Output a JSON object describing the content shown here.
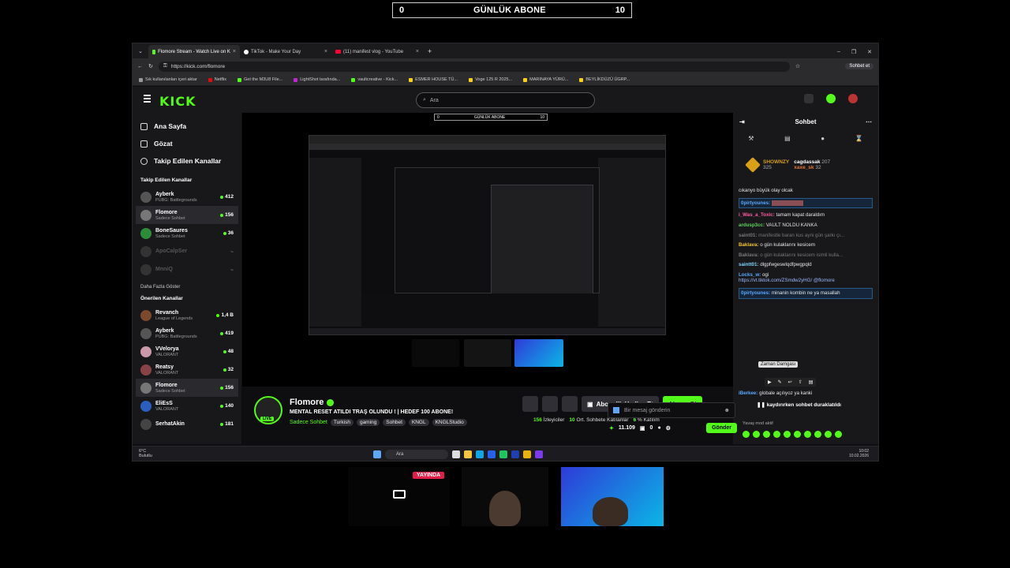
{
  "overlay": {
    "left": "0",
    "title": "GÜNLÜK ABONE",
    "right": "10"
  },
  "browser": {
    "tabs": [
      {
        "label": "Flomore Stream - Watch Live on K",
        "active": true
      },
      {
        "label": "TikTok - Make Your Day",
        "active": false
      },
      {
        "label": "(11) manifest vlog - YouTube",
        "active": false
      }
    ],
    "url": "https://kick.com/flomore",
    "profile_label": "Sohbet et",
    "bookmarks": [
      "Sık kullanılanları içeri aktar",
      "Netflix",
      "Get the M3U8 File...",
      "LightShot tarafında...",
      "vaultcreative - Kick...",
      "ESMER HOUSE TÜ...",
      "Voge 125 R 2025...",
      "MARINAYA YÜRÜ...",
      "BEYLİKDÜZÜ ÜGRP..."
    ]
  },
  "kick": {
    "logo": "KICK",
    "search_placeholder": "Ara",
    "nav": [
      "Ana Sayfa",
      "Gözat",
      "Takip Edilen Kanallar"
    ],
    "followed_title": "Takip Edilen Kanallar",
    "followed": [
      {
        "name": "Ayberk",
        "sub": "PUBG: Battlegrounds",
        "count": "412"
      },
      {
        "name": "Flomore",
        "sub": "Sadece Sohbet",
        "count": "156"
      },
      {
        "name": "BoneSaures",
        "sub": "Sadece Sohbet",
        "count": "36"
      },
      {
        "name": "ApoCalpSer",
        "sub": "",
        "count": ""
      },
      {
        "name": "MnniQ",
        "sub": "",
        "count": ""
      }
    ],
    "show_more": "Daha Fazla Göster",
    "suggested_title": "Önerilen Kanallar",
    "suggested": [
      {
        "name": "Revanch",
        "sub": "League of Legends",
        "count": "1,4 B"
      },
      {
        "name": "Ayberk",
        "sub": "PUBG: Battlegrounds",
        "count": "419"
      },
      {
        "name": "VVelorya",
        "sub": "VALORANT",
        "count": "48"
      },
      {
        "name": "Reatsy",
        "sub": "VALORANT",
        "count": "32"
      },
      {
        "name": "Flomore",
        "sub": "Sadece Sohbet",
        "count": "156"
      },
      {
        "name": "EliEsS",
        "sub": "VALORANT",
        "count": "140"
      },
      {
        "name": "SerhatAkin",
        "sub": "",
        "count": "181"
      }
    ]
  },
  "stream": {
    "name": "Flomore",
    "live_badge": "LIVE",
    "title": "MENTAL RESET ATILDI TRAŞ OLUNDU ! | HEDEF 100 ABONE!",
    "category": "Sadece Sohbet",
    "tags": [
      "Turkish",
      "gaming",
      "Sohbet",
      "KNGL",
      "KNGLStudio"
    ],
    "gift_button": "Abonelik Hediye Et",
    "subscribe_button": "Abone Ol",
    "viewers": "156",
    "viewers_label": "İzleyiciler",
    "chatters": "10",
    "chatters_label": "Ort. Sohbete Katılanlar",
    "rate": "6",
    "rate_label": "% Katılım"
  },
  "chat": {
    "title": "Sohbet",
    "pinned": {
      "user1": "SHOWNZY",
      "user1_count": "325",
      "user2": "cagdassak",
      "user2_count": "207",
      "user3": "xaxe_sk",
      "user3_count": "32"
    },
    "messages": [
      {
        "user": "",
        "text": "cıkanyo büyük olay olcak",
        "style": ""
      },
      {
        "user": "0pirtyounes:",
        "text": "",
        "style": "hl"
      },
      {
        "user": "i_Was_a_Toxic:",
        "text": "tamam kapat daraldım",
        "style": ""
      },
      {
        "user": "ardusp3cc:",
        "text": "VAULT NOLDU KANKA",
        "style": ""
      },
      {
        "user": "saint01:",
        "text": "manifestle baran kus ayni gün şarkı çı...",
        "style": "dim"
      },
      {
        "user": "Baklava:",
        "text": "o gün kulaklarını kesicem",
        "style": ""
      },
      {
        "user": "Baklava:",
        "text": "o gün kulaklarını kesicem isimli kulla...",
        "style": "dim"
      },
      {
        "user": "saintt01:",
        "text": "dlgpfwgeswlqdfpwgpqld",
        "style": ""
      },
      {
        "user": "Locks_w:",
        "text": "ogi",
        "style": ""
      },
      {
        "user": "",
        "text": "https://vt.tiktok.com/ZSmdw2yHG/ @flomore",
        "style": ""
      },
      {
        "user": "0pirtyounes:",
        "text": "minanin kombin ne ya masallah",
        "style": "hl"
      }
    ],
    "tooltip": "Zaman Damgası",
    "late_messages": [
      {
        "user": "iBerkee:",
        "text": "globale açılıyoz ya kanki"
      }
    ],
    "pause_notice": "kaydırırken sohbet duraklatıldı",
    "slow_mode": "Yavaş mod aktif",
    "input_placeholder": "Bir mesaj gönderin",
    "points": "11.109",
    "zero": "0",
    "send": "Gönder"
  },
  "taskbar": {
    "weather": "6°C",
    "weather_sub": "Bulutlu",
    "search": "Ara",
    "time": "10:02",
    "date": "10.02.2026"
  },
  "cams": {
    "live_label": "YAYINDA"
  },
  "colors": {
    "accent": "#53fc18",
    "bg": "#0e0e10",
    "panel": "#18181b"
  }
}
